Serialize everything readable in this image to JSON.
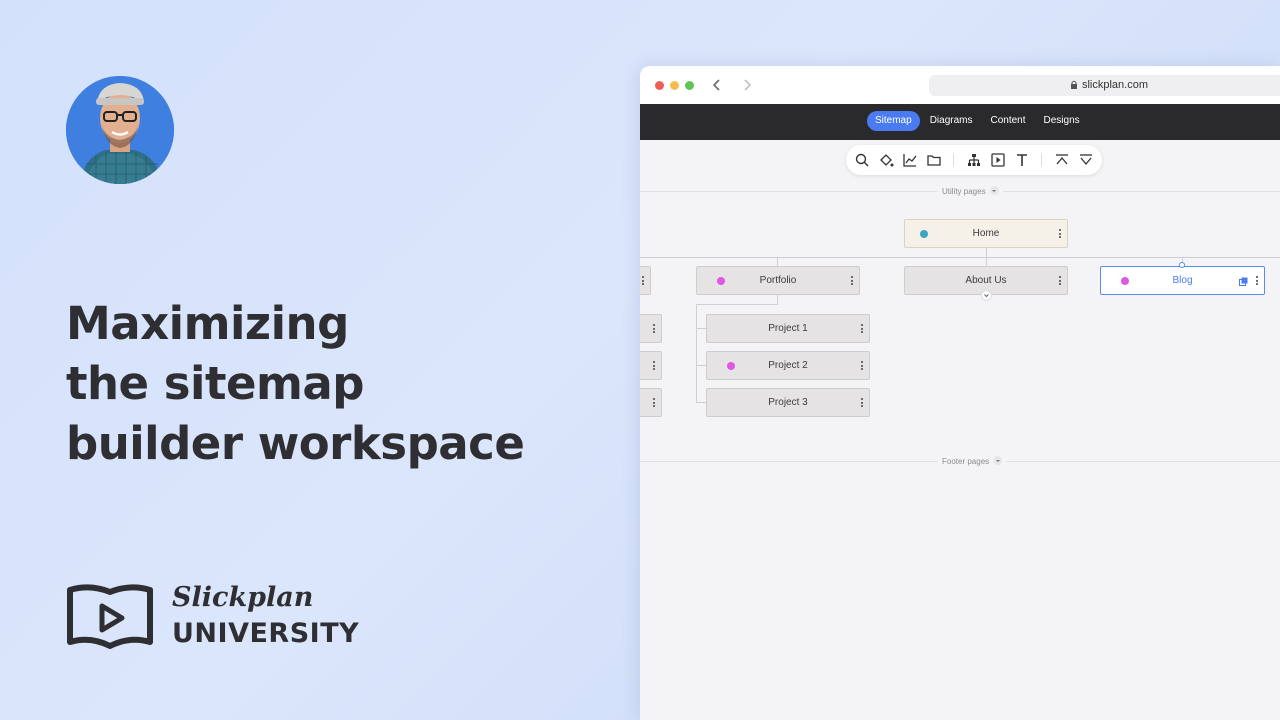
{
  "headline": {
    "line1": "Maximizing",
    "line2": "the sitemap",
    "line3": "builder workspace"
  },
  "brand": {
    "script": "Slickplan",
    "university": "UNIVERSITY",
    "icon": "book-play-icon"
  },
  "browser": {
    "url": "slickplan.com",
    "lock_icon": "lock-icon",
    "back_icon": "chevron-left-icon",
    "forward_icon": "chevron-right-icon",
    "window_dots": [
      "#ec5f57",
      "#f4bd4f",
      "#5fc453"
    ]
  },
  "app_nav": {
    "items": [
      {
        "label": "Sitemap",
        "active": true
      },
      {
        "label": "Diagrams",
        "active": false
      },
      {
        "label": "Content",
        "active": false
      },
      {
        "label": "Designs",
        "active": false
      }
    ],
    "accent": "#4b7bf0"
  },
  "toolbar": {
    "tools": [
      "search-icon",
      "paint-bucket-icon",
      "chart-line-icon",
      "folder-icon",
      "sitemap-icon",
      "play-box-icon",
      "text-icon",
      "collapse-up-icon",
      "expand-down-icon"
    ]
  },
  "sections": {
    "utility": "Utility pages",
    "footer": "Footer pages"
  },
  "nodes": {
    "home": {
      "label": "Home",
      "dot_color": "#3ea6c4"
    },
    "portfolio": {
      "label": "Portfolio",
      "dot_color": "#e056e6"
    },
    "about": {
      "label": "About Us"
    },
    "blog": {
      "label": "Blog",
      "dot_color": "#e056e6"
    },
    "project1": {
      "label": "Project 1"
    },
    "project2": {
      "label": "Project 2",
      "dot_color": "#e056e6"
    },
    "project3": {
      "label": "Project 3"
    }
  }
}
